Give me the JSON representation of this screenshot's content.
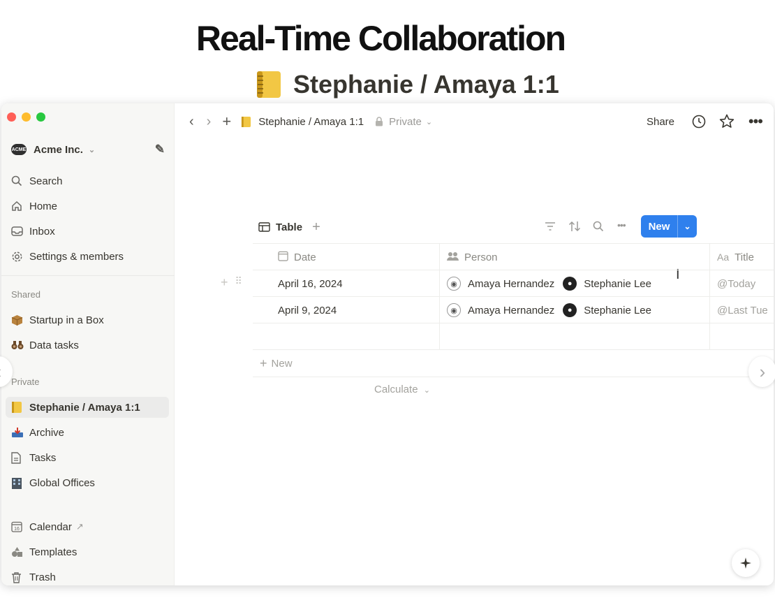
{
  "headline": "Real-Time Collaboration",
  "colors": {
    "accent": "#2f80ed",
    "close": "#ff5f57",
    "minimize": "#febc2e",
    "zoom": "#28c840"
  },
  "sidebar": {
    "workspace": "Acme Inc.",
    "workspace_logo": "ACME",
    "nav": [
      {
        "icon": "search-icon",
        "label": "Search"
      },
      {
        "icon": "home-icon",
        "label": "Home"
      },
      {
        "icon": "inbox-icon",
        "label": "Inbox"
      },
      {
        "icon": "gear-icon",
        "label": "Settings & members"
      }
    ],
    "shared_label": "Shared",
    "shared": [
      {
        "icon": "box-icon",
        "label": "Startup in a Box"
      },
      {
        "icon": "binoculars-icon",
        "label": "Data tasks"
      }
    ],
    "private_label": "Private",
    "private": [
      {
        "icon": "notebook-icon",
        "label": "Stephanie / Amaya 1:1"
      },
      {
        "icon": "inbox-tray-icon",
        "label": "Archive"
      },
      {
        "icon": "page-icon",
        "label": "Tasks"
      },
      {
        "icon": "building-icon",
        "label": "Global Offices"
      }
    ],
    "bottom": [
      {
        "icon": "calendar-icon",
        "label": "Calendar",
        "calendar_day": "16"
      },
      {
        "icon": "shapes-icon",
        "label": "Templates"
      },
      {
        "icon": "trash-icon",
        "label": "Trash"
      }
    ]
  },
  "topbar": {
    "breadcrumb": "Stephanie / Amaya 1:1",
    "visibility": "Private",
    "share": "Share"
  },
  "page": {
    "title": "Stephanie / Amaya 1:1",
    "view_tab": "Table",
    "new_button": "New"
  },
  "table": {
    "headers": [
      "Date",
      "Person",
      "Title"
    ],
    "header_prefix_title": "Aa",
    "rows": [
      {
        "date": "April 16, 2024",
        "person_1": "Amaya Hernandez",
        "person_2": "Stephanie Lee",
        "title": "@Today"
      },
      {
        "date": "April 9, 2024",
        "person_1": "Amaya Hernandez",
        "person_2": "Stephanie Lee",
        "title": "@Last Tue"
      }
    ],
    "new_row": "New",
    "calculate": "Calculate"
  }
}
